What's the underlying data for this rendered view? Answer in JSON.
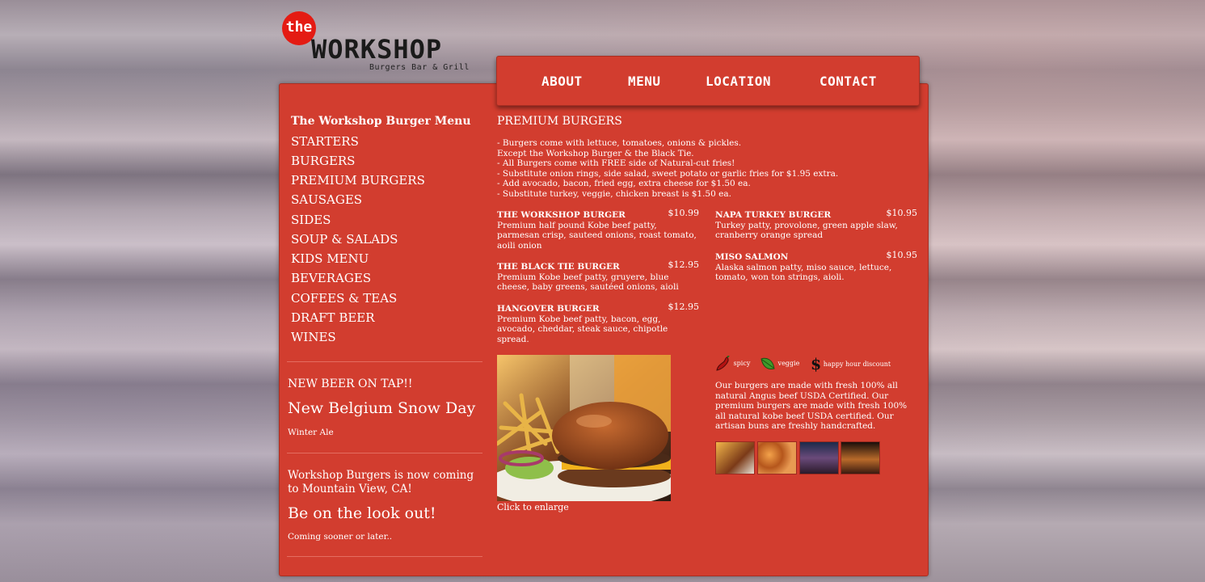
{
  "logo": {
    "the": "the",
    "word": "WORKSHOP",
    "tagline": "Burgers Bar & Grill"
  },
  "nav": [
    "ABOUT",
    "MENU",
    "LOCATION",
    "CONTACT"
  ],
  "sidebar": {
    "title": "The Workshop Burger Menu",
    "links": [
      "STARTERS",
      "BURGERS",
      "PREMIUM BURGERS",
      "SAUSAGES",
      "SIDES",
      "SOUP & SALADS",
      "KIDS MENU",
      "BEVERAGES",
      "COFEES & TEAS",
      "DRAFT BEER",
      "WINES"
    ],
    "tap": {
      "label": "NEW BEER ON TAP!!",
      "beer": "New Belgium Snow Day",
      "style": "Winter Ale"
    },
    "news": {
      "headline": "Workshop Burgers is now coming to Mountain View, CA!",
      "call": "Be on the look out!",
      "note": "Coming sooner or later.."
    }
  },
  "section": {
    "title": "PREMIUM BURGERS",
    "notes": [
      "- Burgers come with lettuce, tomatoes, onions & pickles.",
      "Except the Workshop Burger & the Black Tie.",
      "- All Burgers come with FREE side of Natural-cut fries!",
      "- Substitute onion rings, side salad, sweet potato or garlic fries for $1.95 extra.",
      "- Add avocado, bacon, fried egg, extra cheese for $1.50 ea.",
      "- Substitute turkey, veggie, chicken breast is $1.50 ea."
    ],
    "items": [
      {
        "name": "THE WORKSHOP BURGER",
        "price": "$10.99",
        "desc": "Premium half pound Kobe beef patty, parmesan crisp, sauteed onions, roast tomato, aoili onion"
      },
      {
        "name": "THE BLACK TIE BURGER",
        "price": "$12.95",
        "desc": "Premium Kobe beef patty, gruyere, blue cheese, baby greens, sautéed onions, aioli"
      },
      {
        "name": "HANGOVER BURGER",
        "price": "$12.95",
        "desc": "Premium Kobe beef patty, bacon, egg, avocado, cheddar, steak sauce, chipotle spread."
      },
      {
        "name": "NAPA TURKEY BURGER",
        "price": "$10.95",
        "desc": "Turkey patty, provolone, green apple slaw, cranberry orange spread"
      },
      {
        "name": "MISO SALMON",
        "price": "$10.95",
        "desc": "Alaska salmon patty, miso sauce, lettuce, tomato, won ton strings, aioli."
      }
    ],
    "caption": "Click to enlarge",
    "legend": {
      "spicy": "spicy",
      "veggie": "veggie",
      "happy": "happy hour discount"
    },
    "about": "Our burgers are made with fresh 100% all natural Angus beef USDA Certified. Our premium burgers are made with fresh 100% all natural kobe beef USDA certified. Our artisan buns are freshly handcrafted."
  },
  "colors": {
    "panel": "#d23d2f",
    "logo_red": "#e41b13"
  },
  "icons": [
    "chili-pepper-icon",
    "leaf-icon",
    "dollar-icon"
  ]
}
